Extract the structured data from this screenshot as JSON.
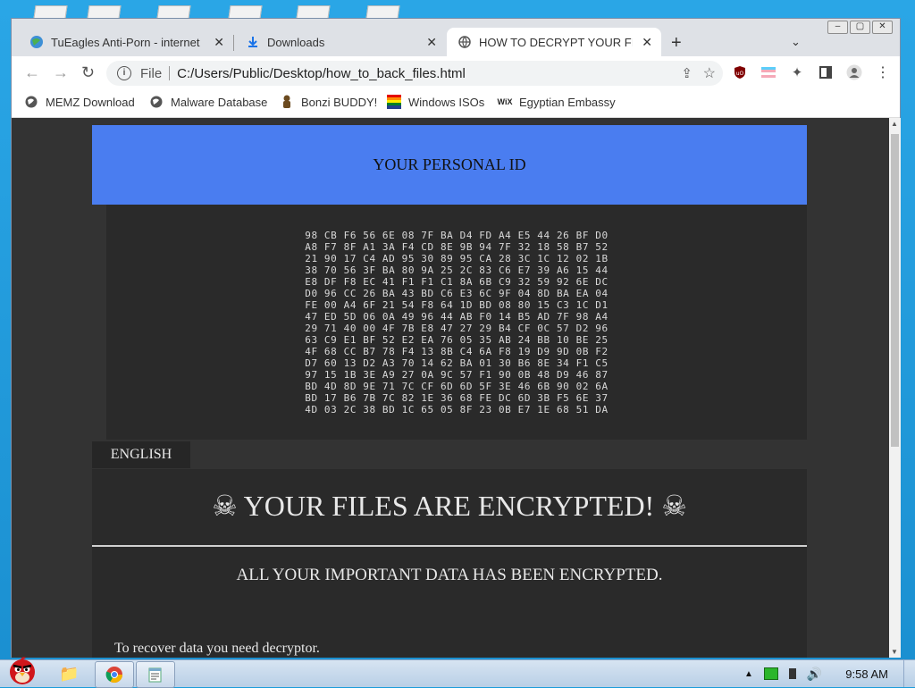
{
  "browser": {
    "tabs": [
      {
        "title": "TuEagles Anti-Porn - internet filter",
        "icon": "globe-icon"
      },
      {
        "title": "Downloads",
        "icon": "download-icon"
      },
      {
        "title": "HOW TO DECRYPT YOUR FILES",
        "icon": "globe-icon",
        "active": true
      }
    ],
    "new_tab": "+",
    "address": {
      "scheme_label": "File",
      "url": "C:/Users/Public/Desktop/how_to_back_files.html"
    },
    "bookmarks": [
      {
        "label": "MEMZ Download",
        "icon": "globe-icon"
      },
      {
        "label": "Malware Database",
        "icon": "globe-icon"
      },
      {
        "label": "Bonzi BUDDY!",
        "icon": "bonzi-icon"
      },
      {
        "label": "Windows ISOs",
        "icon": "windows-flag-icon"
      },
      {
        "label": "Egyptian Embassy",
        "icon": "wix-icon"
      }
    ]
  },
  "page": {
    "personal_id_title": "YOUR PERSONAL ID",
    "personal_id_hex": "98 CB F6 56 6E 08 7F BA D4 FD A4 E5 44 26 BF D0\nA8 F7 8F A1 3A F4 CD 8E 9B 94 7F 32 18 58 B7 52\n21 90 17 C4 AD 95 30 89 95 CA 28 3C 1C 12 02 1B\n38 70 56 3F BA 80 9A 25 2C 83 C6 E7 39 A6 15 44\nE8 DF F8 EC 41 F1 F1 C1 8A 6B C9 32 59 92 6E DC\nD0 96 CC 26 BA 43 BD C6 E3 6C 9F 04 8D BA EA 04\nFE 00 A4 6F 21 54 F8 64 1D BD 08 80 15 C3 1C D1\n47 ED 5D 06 0A 49 96 44 AB F0 14 B5 AD 7F 98 A4\n29 71 40 00 4F 7B E8 47 27 29 B4 CF 0C 57 D2 96\n63 C9 E1 BF 52 E2 EA 76 05 35 AB 24 BB 10 BE 25\n4F 68 CC B7 78 F4 13 8B C4 6A F8 19 D9 9D 0B F2\nD7 60 13 D2 A3 70 14 62 BA 01 30 B6 8E 34 F1 C5\n97 15 1B 3E A9 27 0A 9C 57 F1 90 0B 48 D9 46 87\nBD 4D 8D 9E 71 7C CF 6D 6D 5F 3E 46 6B 90 02 6A\nBD 17 B6 7B 7C 82 1E 36 68 FE DC 6D 3B F5 6E 37\n4D 03 2C 38 BD 1C 65 05 8F 23 0B E7 1E 68 51 DA",
    "language_tab": "ENGLISH",
    "headline": "☠ YOUR FILES ARE ENCRYPTED! ☠",
    "subheadline": "ALL YOUR IMPORTANT DATA HAS BEEN ENCRYPTED.",
    "paragraph": "To recover data you need decryptor."
  },
  "taskbar": {
    "clock": "9:58 AM"
  },
  "colors": {
    "id_header": "#4a7df0",
    "page_bg": "#333333",
    "panel_bg": "#2a2a2a"
  }
}
